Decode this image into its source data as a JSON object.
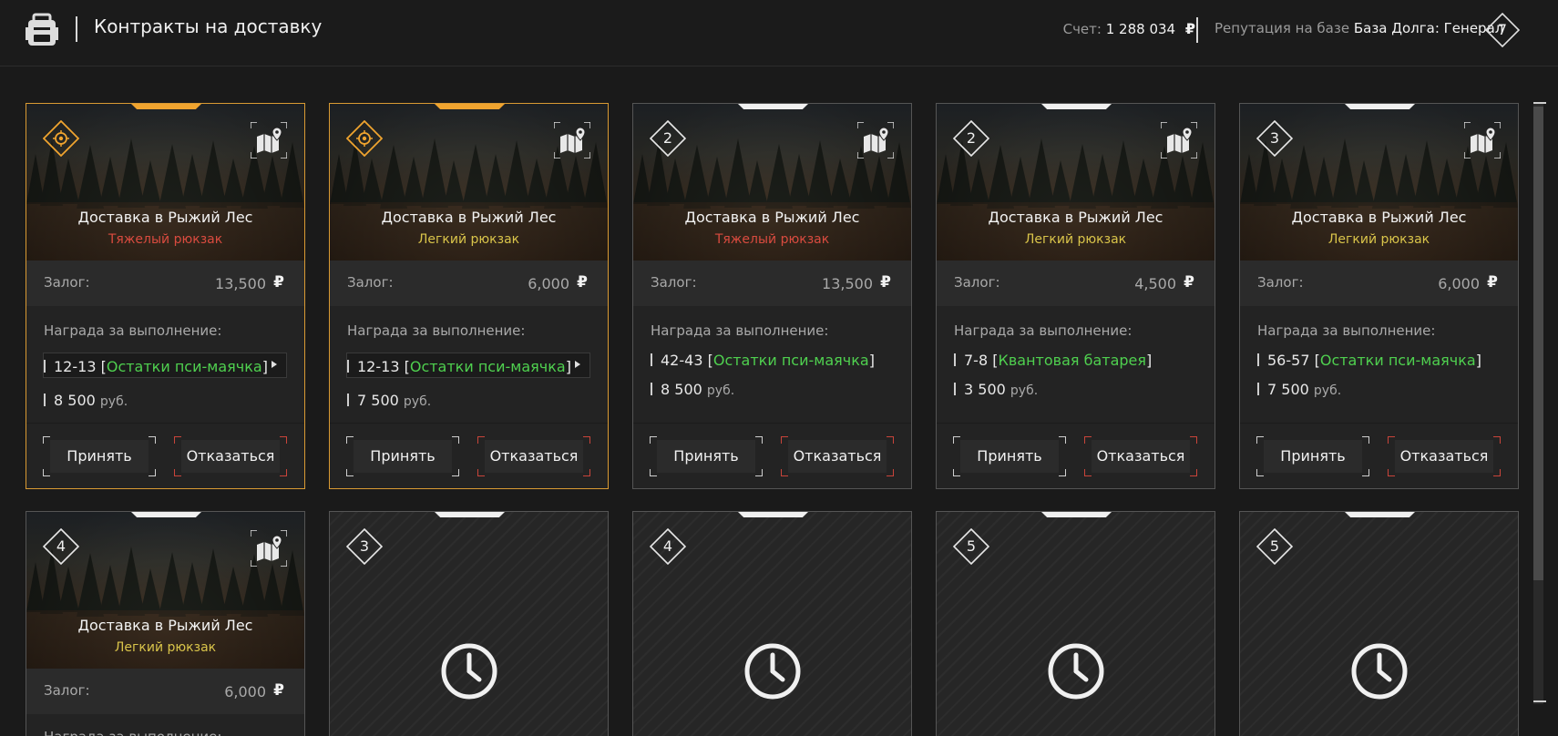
{
  "header": {
    "title": "Контракты на доставку",
    "balance_label": "Счет:",
    "balance_value": "1 288 034",
    "currency_symbol": "₽",
    "reputation_label": "Репутация на базе",
    "reputation_value": "База Долга: Генерал",
    "level": "7"
  },
  "ui": {
    "deposit_label": "Залог:",
    "reward_label": "Награда за выполнение:",
    "accept_label": "Принять",
    "decline_label": "Отказаться",
    "money_unit": "руб."
  },
  "cards": [
    {
      "level": "",
      "title": "Доставка в Рыжий Лес",
      "subtitle": "Тяжелый рюкзак",
      "deposit": "13,500",
      "reward_qty": "12-13",
      "reward_item": "Остатки пси-маячка",
      "reward_money": "8 500"
    },
    {
      "level": "",
      "title": "Доставка в Рыжий Лес",
      "subtitle": "Легкий рюкзак",
      "deposit": "6,000",
      "reward_qty": "12-13",
      "reward_item": "Остатки пси-маячка",
      "reward_money": "7 500"
    },
    {
      "level": "2",
      "title": "Доставка в Рыжий Лес",
      "subtitle": "Тяжелый рюкзак",
      "deposit": "13,500",
      "reward_qty": "42-43",
      "reward_item": "Остатки пси-маячка",
      "reward_money": "8 500"
    },
    {
      "level": "2",
      "title": "Доставка в Рыжий Лес",
      "subtitle": "Легкий рюкзак",
      "deposit": "4,500",
      "reward_qty": "7-8",
      "reward_item": "Квантовая батарея",
      "reward_money": "3 500"
    },
    {
      "level": "3",
      "title": "Доставка в Рыжий Лес",
      "subtitle": "Легкий рюкзак",
      "deposit": "6,000",
      "reward_qty": "56-57",
      "reward_item": "Остатки пси-маячка",
      "reward_money": "7 500"
    },
    {
      "level": "4",
      "title": "Доставка в Рыжий Лес",
      "subtitle": "Легкий рюкзак",
      "deposit": "6,000",
      "reward_label_partial": "Награда за выполнение:"
    }
  ],
  "locked_cards": [
    {
      "level": "3"
    },
    {
      "level": "4"
    },
    {
      "level": "5"
    },
    {
      "level": "5"
    }
  ],
  "colors": {
    "featured_border": "#d99a33",
    "heavy_subtitle": "#d94b3f",
    "light_subtitle": "#d9c44a",
    "reward_item": "#4fd04f",
    "decline_accent": "#c9443a"
  },
  "icons": [
    "backpack-icon",
    "ruble-icon",
    "level-diamond-icon",
    "faction-emblem-icon",
    "map-pin-icon",
    "clock-icon",
    "expand-arrow-icon"
  ]
}
